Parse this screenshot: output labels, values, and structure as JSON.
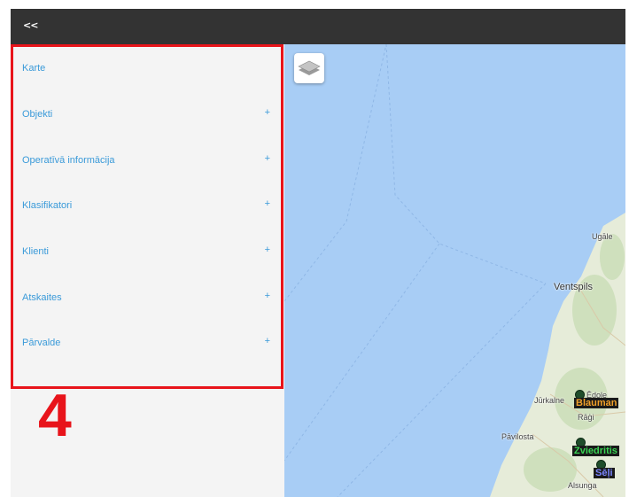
{
  "topbar": {
    "collapse_label": "<<"
  },
  "sidebar": {
    "items": [
      {
        "label": "Karte",
        "expandable": false
      },
      {
        "label": "Objekti",
        "expandable": true
      },
      {
        "label": "Operatīvā informācija",
        "expandable": true
      },
      {
        "label": "Klasifikatori",
        "expandable": true
      },
      {
        "label": "Klienti",
        "expandable": true
      },
      {
        "label": "Atskaites",
        "expandable": true
      },
      {
        "label": "Pārvalde",
        "expandable": true
      }
    ],
    "expand_symbol": "+"
  },
  "annotation": {
    "number": "4",
    "color": "#e8141b"
  },
  "map": {
    "place_labels": {
      "ventspils": "Ventspils",
      "ugale": "Ugāle",
      "jurkalne": "Jūrkalne",
      "edole": "Ēdole",
      "pavilosta": "Pāvilosta",
      "alsunga": "Alsunga",
      "ragi": "Rāģi"
    },
    "markers": [
      {
        "label": "Blauman",
        "color": "#f2a12a"
      },
      {
        "label": "Zviedritis",
        "color": "#39d353"
      },
      {
        "label": "Sēļi",
        "color": "#7a86ff"
      }
    ],
    "colors": {
      "sea": "#a8cdf5",
      "land": "#e6ecd9",
      "forest": "#cfe0bd"
    }
  }
}
